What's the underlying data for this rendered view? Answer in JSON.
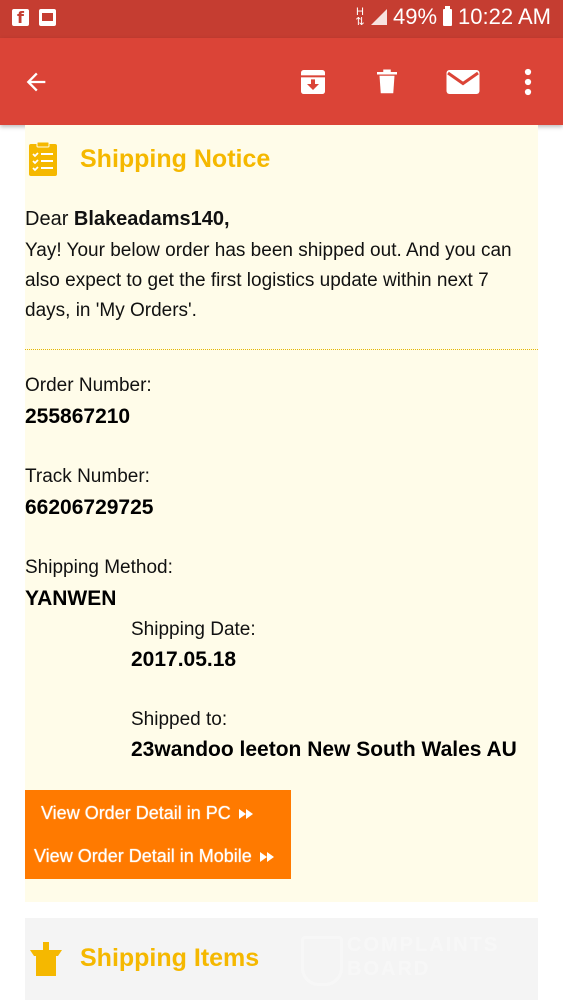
{
  "status_bar": {
    "battery": "49%",
    "time": "10:22 AM",
    "network_type": "H",
    "icons": [
      "facebook-icon",
      "gallery-icon",
      "signal-icon",
      "battery-icon"
    ]
  },
  "app_bar": {
    "color": "#db4437",
    "actions": [
      "back-icon",
      "archive-icon",
      "delete-icon",
      "mail-icon",
      "more-vert-icon"
    ]
  },
  "email": {
    "section_title": "Shipping Notice",
    "greeting": "Dear ",
    "username": "Blakeadams140,",
    "message": "Yay! Your below order has been shipped out. And you can also expect to get the first logistics update within next 7 days, in 'My Orders'.",
    "order_number_label": "Order Number:",
    "order_number": "255867210",
    "track_number_label": "Track Number:",
    "track_number": "66206729725",
    "shipping_method_label": "Shipping Method:",
    "shipping_method": "YANWEN",
    "shipping_date_label": "Shipping Date:",
    "shipping_date": "2017.05.18",
    "shipped_to_label": "Shipped to:",
    "shipped_to": "23wandoo leeton New South Wales AU",
    "view_pc_button": "View Order Detail in PC",
    "view_mobile_button": "View Order Detail in Mobile",
    "items_title": "Shipping Items",
    "watermark_line1": "COMPLAINTS",
    "watermark_line2": "BOARD"
  },
  "colors": {
    "status_bar": "#c53d31",
    "accent_yellow": "#f5b800",
    "button_orange": "#ff7a00",
    "email_background": "#fffce9"
  }
}
